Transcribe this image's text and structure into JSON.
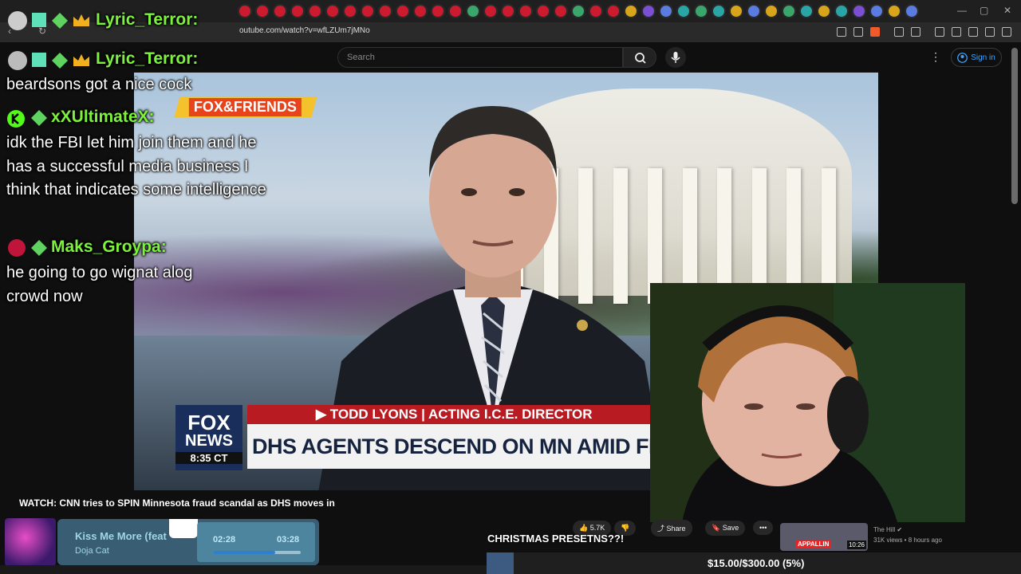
{
  "browser": {
    "url": "outube.com/watch?v=wfLZUm7jMNo",
    "tab_colors": [
      "#cc1a2e",
      "#cc1a2e",
      "#cc1a2e",
      "#cc1a2e",
      "#cc1a2e",
      "#cc1a2e",
      "#cc1a2e",
      "#cc1a2e",
      "#cc1a2e",
      "#cc1a2e",
      "#cc1a2e",
      "#cc1a2e",
      "#cc1a2e",
      "#3aa66b",
      "#cc1a2e",
      "#cc1a2e",
      "#cc1a2e",
      "#cc1a2e",
      "#cc1a2e",
      "#3aa66b",
      "#cc1a2e",
      "#cc1a2e",
      "#d8a419",
      "#7a4fd2",
      "#5a7be0",
      "#2aa5a5",
      "#3aa66b",
      "#2aa5a5",
      "#d8a419",
      "#5a7be0",
      "#d8a419",
      "#3aa66b",
      "#2aa5a5",
      "#d8a419",
      "#2aa5a5",
      "#7a4fd2",
      "#5a7be0",
      "#d8a419",
      "#5a7be0"
    ]
  },
  "youtube": {
    "search_placeholder": "Search",
    "signin_label": "Sign in",
    "video_title": "WATCH: CNN tries to SPIN Minnesota fraud scandal as DHS moves in",
    "likes": "5.7K",
    "share_label": "Share",
    "save_label": "Save",
    "side_video": {
      "channel": "The Hill",
      "meta": "31K views • 8 hours ago",
      "duration": "10:26",
      "thumb_text": "APPALLIN"
    }
  },
  "broadcast": {
    "show_logo": "FOX&FRIENDS",
    "network_line1": "FOX",
    "network_line2": "NEWS",
    "clock": "8:35 CT",
    "name_bar": "▶ TODD LYONS | ACTING I.C.E. DIRECTOR",
    "headline": "DHS AGENTS DESCEND ON MN AMID FRAUD INVESTIGATI"
  },
  "chat": {
    "top_username": "Lyric_Terror:",
    "messages": [
      {
        "user": "Lyric_Terror:",
        "text": "beardsons got a nice cock"
      },
      {
        "user": "xXUltimateX:",
        "text": "idk the FBI let him join them and he has a successful media business I think that indicates some intelligence"
      },
      {
        "user": "Maks_Groypa:",
        "text": "he going to go wignat alog crowd now"
      }
    ],
    "username_color": "#7cf23d"
  },
  "music": {
    "song": "Kiss Me More (feat",
    "artist": "Doja Cat",
    "elapsed": "02:28",
    "total": "03:28",
    "progress_fraction": 0.712
  },
  "stream": {
    "banner": "CHRISTMAS PRESETNS??!",
    "donation_text": "$15.00/$300.00 (5%)",
    "donation_fraction": 0.05
  }
}
